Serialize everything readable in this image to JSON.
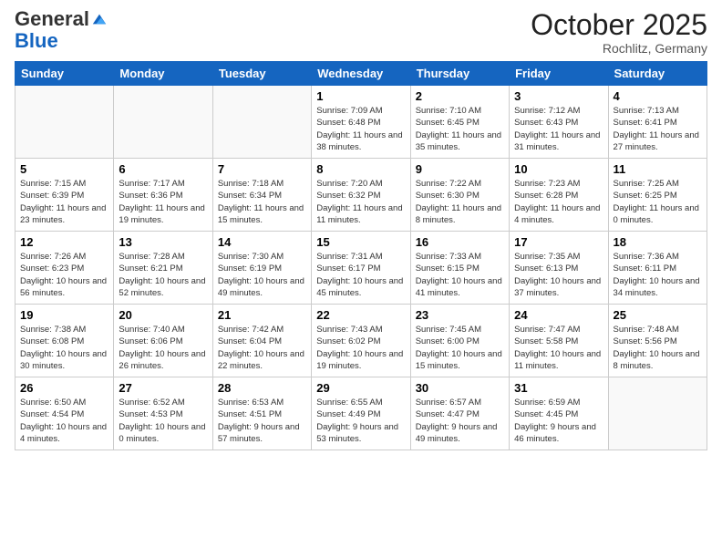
{
  "header": {
    "logo_general": "General",
    "logo_blue": "Blue",
    "month": "October 2025",
    "location": "Rochlitz, Germany"
  },
  "weekdays": [
    "Sunday",
    "Monday",
    "Tuesday",
    "Wednesday",
    "Thursday",
    "Friday",
    "Saturday"
  ],
  "weeks": [
    [
      {
        "day": "",
        "info": ""
      },
      {
        "day": "",
        "info": ""
      },
      {
        "day": "",
        "info": ""
      },
      {
        "day": "1",
        "info": "Sunrise: 7:09 AM\nSunset: 6:48 PM\nDaylight: 11 hours\nand 38 minutes."
      },
      {
        "day": "2",
        "info": "Sunrise: 7:10 AM\nSunset: 6:45 PM\nDaylight: 11 hours\nand 35 minutes."
      },
      {
        "day": "3",
        "info": "Sunrise: 7:12 AM\nSunset: 6:43 PM\nDaylight: 11 hours\nand 31 minutes."
      },
      {
        "day": "4",
        "info": "Sunrise: 7:13 AM\nSunset: 6:41 PM\nDaylight: 11 hours\nand 27 minutes."
      }
    ],
    [
      {
        "day": "5",
        "info": "Sunrise: 7:15 AM\nSunset: 6:39 PM\nDaylight: 11 hours\nand 23 minutes."
      },
      {
        "day": "6",
        "info": "Sunrise: 7:17 AM\nSunset: 6:36 PM\nDaylight: 11 hours\nand 19 minutes."
      },
      {
        "day": "7",
        "info": "Sunrise: 7:18 AM\nSunset: 6:34 PM\nDaylight: 11 hours\nand 15 minutes."
      },
      {
        "day": "8",
        "info": "Sunrise: 7:20 AM\nSunset: 6:32 PM\nDaylight: 11 hours\nand 11 minutes."
      },
      {
        "day": "9",
        "info": "Sunrise: 7:22 AM\nSunset: 6:30 PM\nDaylight: 11 hours\nand 8 minutes."
      },
      {
        "day": "10",
        "info": "Sunrise: 7:23 AM\nSunset: 6:28 PM\nDaylight: 11 hours\nand 4 minutes."
      },
      {
        "day": "11",
        "info": "Sunrise: 7:25 AM\nSunset: 6:25 PM\nDaylight: 11 hours\nand 0 minutes."
      }
    ],
    [
      {
        "day": "12",
        "info": "Sunrise: 7:26 AM\nSunset: 6:23 PM\nDaylight: 10 hours\nand 56 minutes."
      },
      {
        "day": "13",
        "info": "Sunrise: 7:28 AM\nSunset: 6:21 PM\nDaylight: 10 hours\nand 52 minutes."
      },
      {
        "day": "14",
        "info": "Sunrise: 7:30 AM\nSunset: 6:19 PM\nDaylight: 10 hours\nand 49 minutes."
      },
      {
        "day": "15",
        "info": "Sunrise: 7:31 AM\nSunset: 6:17 PM\nDaylight: 10 hours\nand 45 minutes."
      },
      {
        "day": "16",
        "info": "Sunrise: 7:33 AM\nSunset: 6:15 PM\nDaylight: 10 hours\nand 41 minutes."
      },
      {
        "day": "17",
        "info": "Sunrise: 7:35 AM\nSunset: 6:13 PM\nDaylight: 10 hours\nand 37 minutes."
      },
      {
        "day": "18",
        "info": "Sunrise: 7:36 AM\nSunset: 6:11 PM\nDaylight: 10 hours\nand 34 minutes."
      }
    ],
    [
      {
        "day": "19",
        "info": "Sunrise: 7:38 AM\nSunset: 6:08 PM\nDaylight: 10 hours\nand 30 minutes."
      },
      {
        "day": "20",
        "info": "Sunrise: 7:40 AM\nSunset: 6:06 PM\nDaylight: 10 hours\nand 26 minutes."
      },
      {
        "day": "21",
        "info": "Sunrise: 7:42 AM\nSunset: 6:04 PM\nDaylight: 10 hours\nand 22 minutes."
      },
      {
        "day": "22",
        "info": "Sunrise: 7:43 AM\nSunset: 6:02 PM\nDaylight: 10 hours\nand 19 minutes."
      },
      {
        "day": "23",
        "info": "Sunrise: 7:45 AM\nSunset: 6:00 PM\nDaylight: 10 hours\nand 15 minutes."
      },
      {
        "day": "24",
        "info": "Sunrise: 7:47 AM\nSunset: 5:58 PM\nDaylight: 10 hours\nand 11 minutes."
      },
      {
        "day": "25",
        "info": "Sunrise: 7:48 AM\nSunset: 5:56 PM\nDaylight: 10 hours\nand 8 minutes."
      }
    ],
    [
      {
        "day": "26",
        "info": "Sunrise: 6:50 AM\nSunset: 4:54 PM\nDaylight: 10 hours\nand 4 minutes."
      },
      {
        "day": "27",
        "info": "Sunrise: 6:52 AM\nSunset: 4:53 PM\nDaylight: 10 hours\nand 0 minutes."
      },
      {
        "day": "28",
        "info": "Sunrise: 6:53 AM\nSunset: 4:51 PM\nDaylight: 9 hours\nand 57 minutes."
      },
      {
        "day": "29",
        "info": "Sunrise: 6:55 AM\nSunset: 4:49 PM\nDaylight: 9 hours\nand 53 minutes."
      },
      {
        "day": "30",
        "info": "Sunrise: 6:57 AM\nSunset: 4:47 PM\nDaylight: 9 hours\nand 49 minutes."
      },
      {
        "day": "31",
        "info": "Sunrise: 6:59 AM\nSunset: 4:45 PM\nDaylight: 9 hours\nand 46 minutes."
      },
      {
        "day": "",
        "info": ""
      }
    ]
  ]
}
